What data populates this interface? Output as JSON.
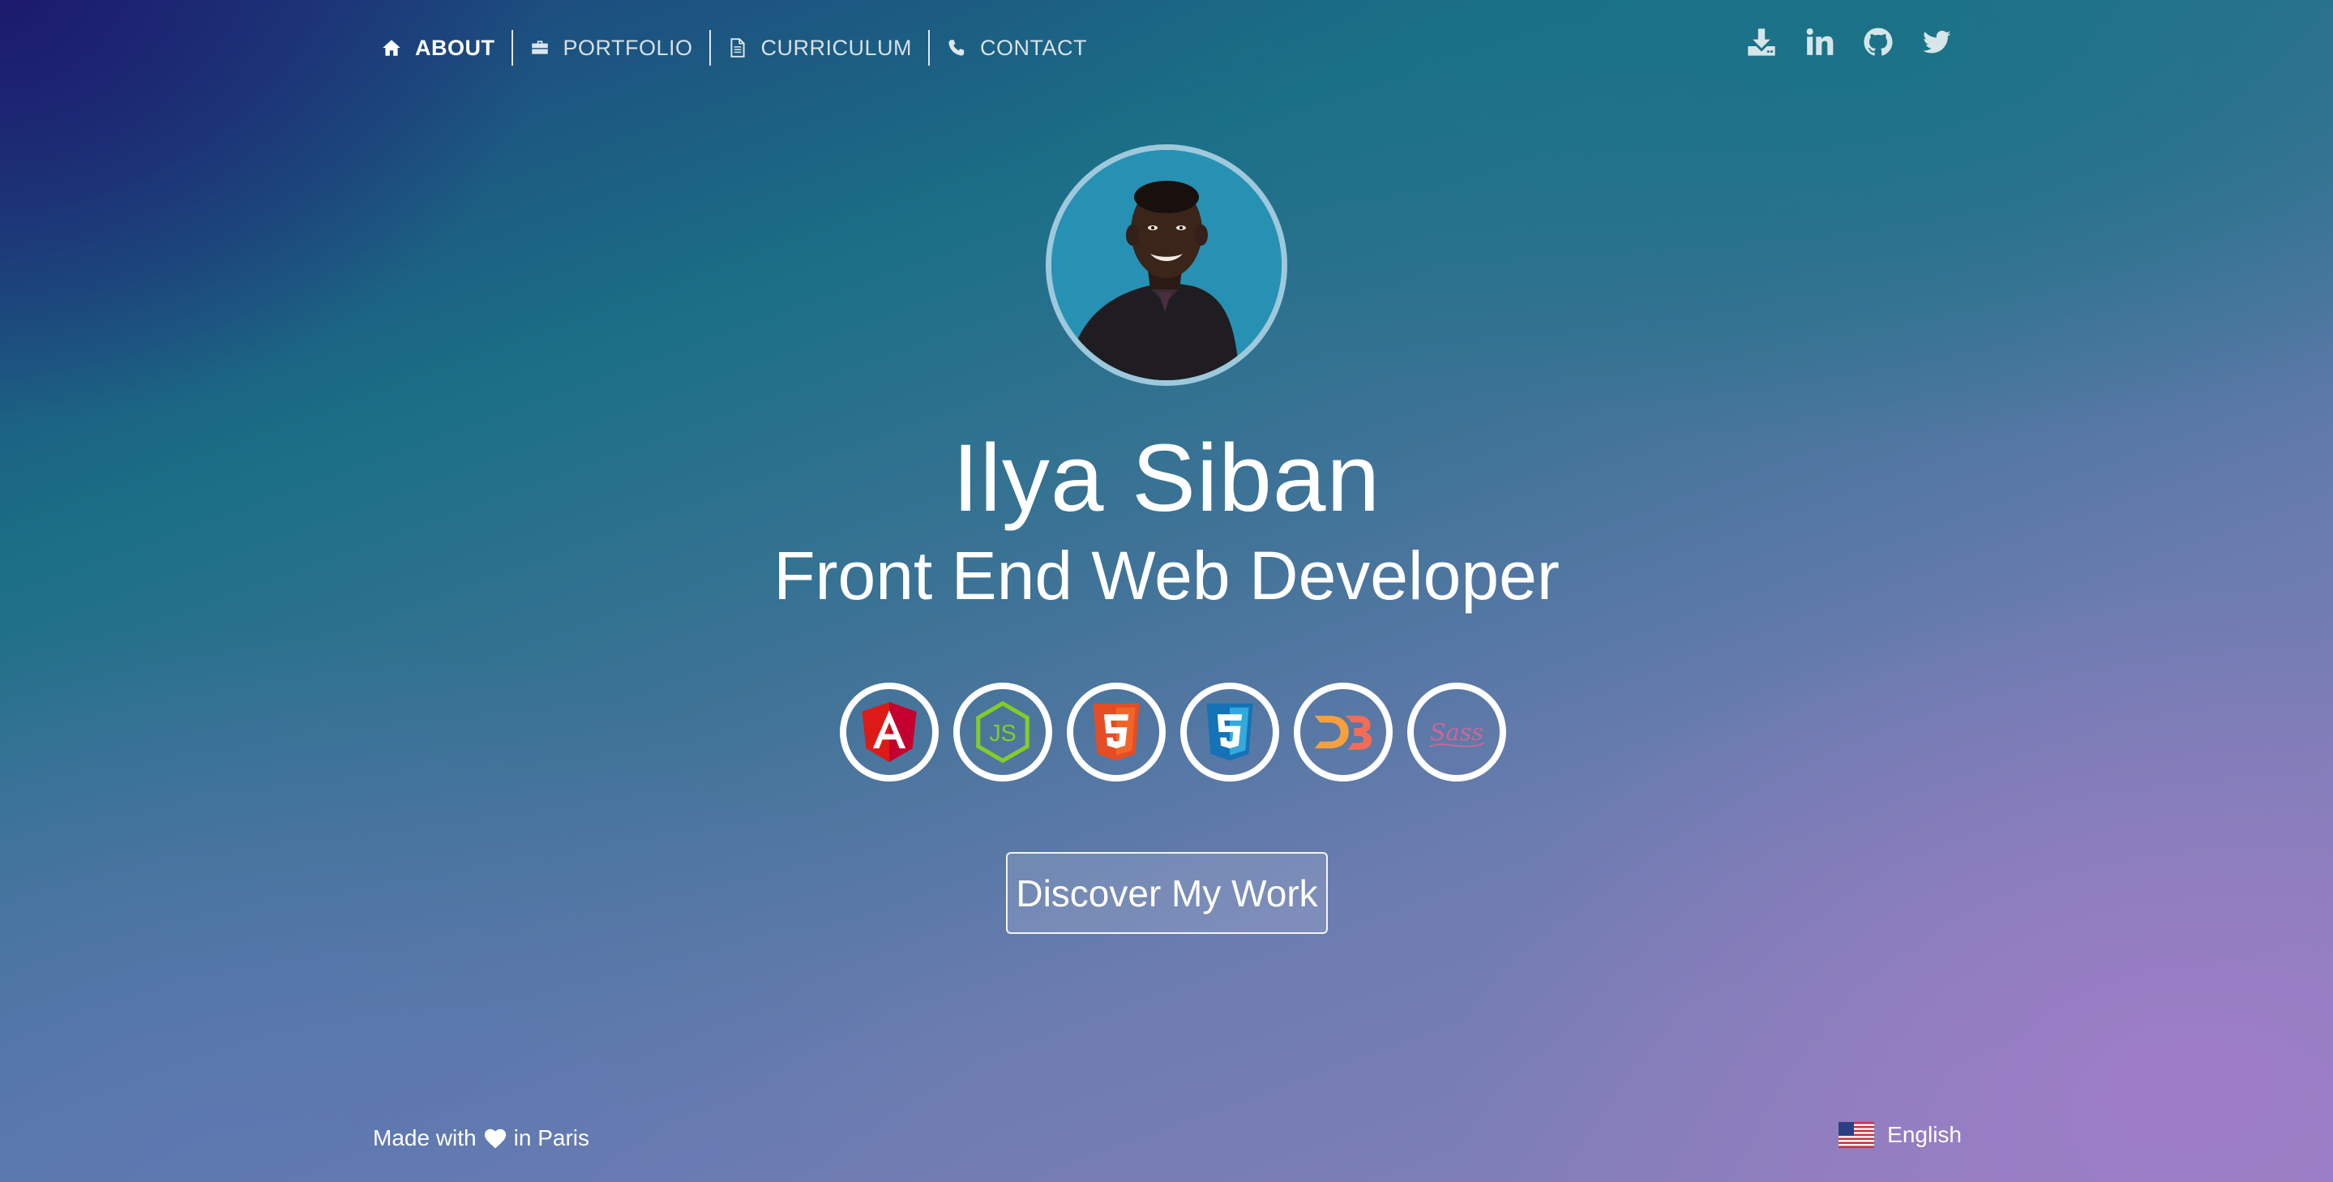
{
  "nav": {
    "items": [
      {
        "label": "ABOUT",
        "icon": "home-icon",
        "active": true
      },
      {
        "label": "PORTFOLIO",
        "icon": "briefcase-icon"
      },
      {
        "label": "CURRICULUM",
        "icon": "document-icon"
      },
      {
        "label": "CONTACT",
        "icon": "phone-icon"
      }
    ]
  },
  "social": [
    "download-icon",
    "linkedin-icon",
    "github-icon",
    "twitter-icon"
  ],
  "hero": {
    "name": "Ilya Siban",
    "title": "Front End Web Developer",
    "cta_label": "Discover My Work"
  },
  "technologies": [
    "angular-icon",
    "nodejs-icon",
    "html5-icon",
    "css3-icon",
    "d3-icon",
    "sass-icon"
  ],
  "footer": {
    "made_with": "Made with",
    "in_city": "in Paris",
    "language": "English"
  },
  "colors": {
    "accent_cyan": "#2791b4",
    "angular": "#dd1b16",
    "node": "#83cd29",
    "html5": "#e44d26",
    "css3": "#1572b6",
    "d3": "#f68e3f",
    "sass": "#cd6799"
  }
}
